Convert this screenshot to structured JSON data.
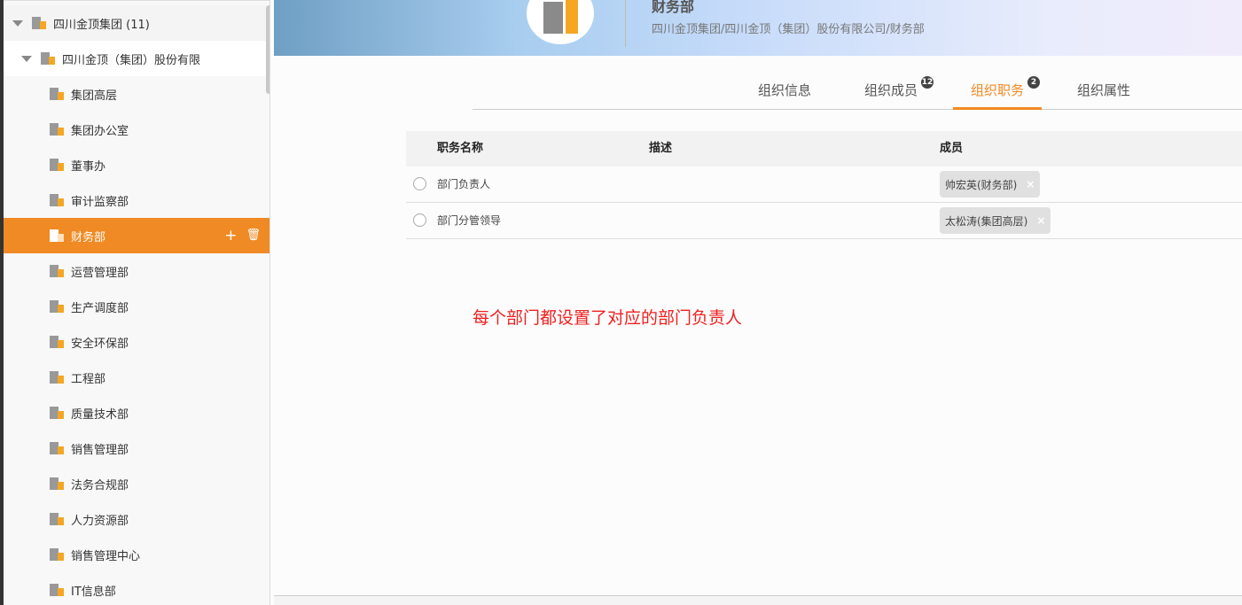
{
  "sidebar": {
    "root": "四川金顶集团 (11)",
    "company": "四川金顶（集团）股份有限",
    "items": [
      {
        "label": "集团高层"
      },
      {
        "label": "集团办公室"
      },
      {
        "label": "董事办"
      },
      {
        "label": "审计监察部"
      },
      {
        "label": "财务部",
        "selected": true
      },
      {
        "label": "运营管理部"
      },
      {
        "label": "生产调度部"
      },
      {
        "label": "安全环保部"
      },
      {
        "label": "工程部"
      },
      {
        "label": "质量技术部"
      },
      {
        "label": "销售管理部"
      },
      {
        "label": "法务合规部"
      },
      {
        "label": "人力资源部"
      },
      {
        "label": "销售管理中心"
      },
      {
        "label": "IT信息部"
      }
    ],
    "add_icon": "+",
    "delete_icon": "🗑"
  },
  "header": {
    "title": "财务部",
    "path": "四川金顶集团/四川金顶（集团）股份有限公司/财务部"
  },
  "tabs": [
    {
      "label": "组织信息"
    },
    {
      "label": "组织成员",
      "badge": "12"
    },
    {
      "label": "组织职务",
      "badge": "2",
      "active": true
    },
    {
      "label": "组织属性"
    }
  ],
  "table": {
    "headers": [
      "职务名称",
      "描述",
      "成员"
    ],
    "rows": [
      {
        "name": "部门负责人",
        "desc": "",
        "member": "帅宏英(财务部)"
      },
      {
        "name": "部门分管领导",
        "desc": "",
        "member": "太松涛(集团高层)"
      }
    ],
    "remove_icon": "×"
  },
  "annotation": "每个部门都设置了对应的部门负责人",
  "colors": {
    "accent": "#f08a24",
    "annotation": "#f02020"
  }
}
